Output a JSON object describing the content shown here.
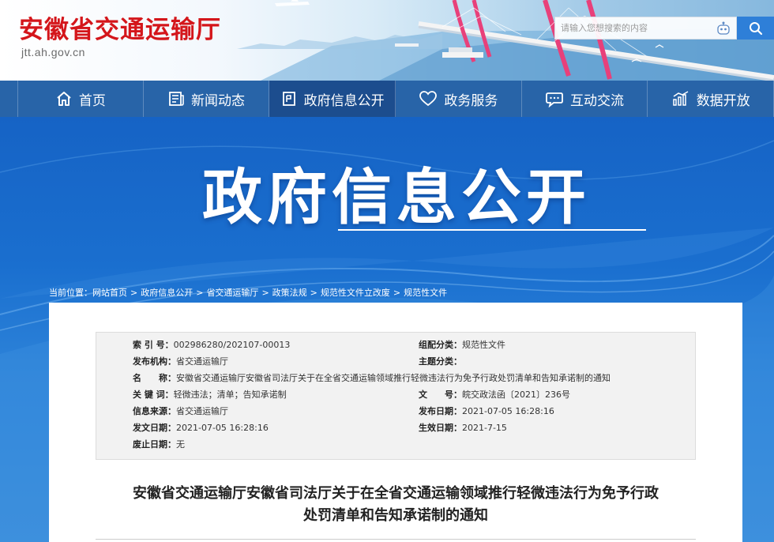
{
  "header": {
    "site_title": "安徽省交通运输厅",
    "site_url": "jtt.ah.gov.cn",
    "search_placeholder": "请输入您想搜索的内容"
  },
  "nav": {
    "items": [
      {
        "label": "首页",
        "icon": "home-icon"
      },
      {
        "label": "新闻动态",
        "icon": "news-icon"
      },
      {
        "label": "政府信息公开",
        "icon": "document-icon"
      },
      {
        "label": "政务服务",
        "icon": "heart-icon"
      },
      {
        "label": "互动交流",
        "icon": "chat-icon"
      },
      {
        "label": "数据开放",
        "icon": "chart-icon"
      }
    ],
    "active_index": 2
  },
  "banner": {
    "title": "政府信息公开"
  },
  "breadcrumb": {
    "prefix": "当前位置：",
    "items": [
      "网站首页",
      "政府信息公开",
      "省交通运输厅",
      "政策法规",
      "规范性文件立改废",
      "规范性文件"
    ],
    "separator": ">"
  },
  "info": {
    "index_label": "索 引 号：",
    "index_value": "002986280/202107-00013",
    "category_label": "组配分类：",
    "category_value": "规范性文件",
    "publisher_label": "发布机构：",
    "publisher_value": "省交通运输厅",
    "topic_label": "主题分类：",
    "topic_value": "",
    "name_label": "名　　称：",
    "name_value": "安徽省交通运输厅安徽省司法厅关于在全省交通运输领域推行轻微违法行为免予行政处罚清单和告知承诺制的通知",
    "keywords_label": "关 键 词：",
    "keywords_value": "轻微违法；清单；告知承诺制",
    "docno_label": "文　　号：",
    "docno_value": "皖交政法函〔2021〕236号",
    "source_label": "信息来源：",
    "source_value": "省交通运输厅",
    "pubdate_label": "发布日期：",
    "pubdate_value": "2021-07-05 16:28:16",
    "issuedate_label": "发文日期：",
    "issuedate_value": "2021-07-05 16:28:16",
    "effective_label": "生效日期：",
    "effective_value": "2021-7-15",
    "expire_label": "废止日期：",
    "expire_value": "无"
  },
  "document": {
    "title_line1": "安徽省交通运输厅安徽省司法厅关于在全省交通运输领域推行轻微违法行为免予行政",
    "title_line2": "处罚清单和告知承诺制的通知"
  },
  "colors": {
    "brand_red": "#d4161b",
    "nav_blue": "#2864a8",
    "nav_active": "#1c4d8e",
    "banner_blue": "#1a6fcf"
  }
}
